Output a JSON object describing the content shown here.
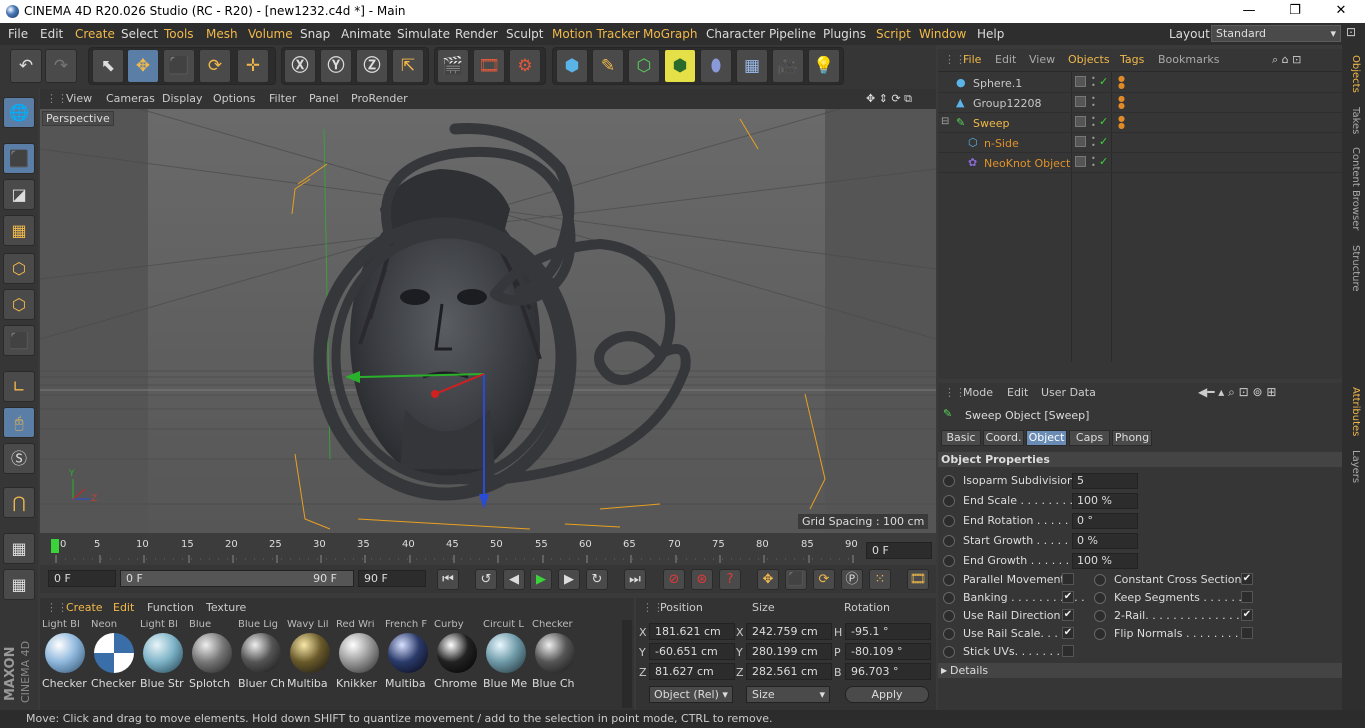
{
  "window": {
    "title": "CINEMA 4D R20.026 Studio (RC - R20) - [new1232.c4d *] - Main",
    "minimize": "—",
    "maximize": "❐",
    "close": "✕"
  },
  "menubar": {
    "items": [
      "File",
      "Edit",
      "Create",
      "Select",
      "Tools",
      "Mesh",
      "Volume",
      "Snap",
      "Animate",
      "Simulate",
      "Render",
      "Sculpt",
      "Motion Tracker",
      "MoGraph",
      "Character",
      "Pipeline",
      "Plugins",
      "Script",
      "Window",
      "Help"
    ],
    "layout_label": "Layout:",
    "layout_value": "Standard",
    "colors": {
      "highlight": "#f2b94a"
    }
  },
  "viewport": {
    "menu": [
      "View",
      "Cameras",
      "Display",
      "Options",
      "Filter",
      "Panel",
      "ProRender"
    ],
    "label": "Perspective",
    "grid_spacing": "Grid Spacing : 100 cm",
    "axis_y": "Y",
    "axis_z": "Z"
  },
  "timeline": {
    "ticks": [
      "0",
      "5",
      "10",
      "15",
      "20",
      "25",
      "30",
      "35",
      "40",
      "45",
      "50",
      "55",
      "60",
      "65",
      "70",
      "75",
      "80",
      "85",
      "90"
    ],
    "current_frame": "0 F"
  },
  "transport": {
    "start": "0 F",
    "range_start": "0 F",
    "range_end": "90 F",
    "end": "90 F"
  },
  "materials": {
    "menu": [
      "Create",
      "Edit",
      "Function",
      "Texture"
    ],
    "items": [
      {
        "top": "Light Bl",
        "label": "Checker",
        "color": "#8fb8dc"
      },
      {
        "top": "Neon",
        "label": "Checker",
        "color": "#3a6ea8"
      },
      {
        "top": "Light Bl",
        "label": "Blue Str",
        "color": "#7fb4c8"
      },
      {
        "top": "Blue",
        "label": "Splotch",
        "color": "#777777"
      },
      {
        "top": "Blue Lig",
        "label": "Bluer Ch",
        "color": "#555555"
      },
      {
        "top": "Wavy Lil",
        "label": "Multiba",
        "color": "#6a5a2a"
      },
      {
        "top": "Red Wri",
        "label": "Knikker",
        "color": "#9a9a9a"
      },
      {
        "top": "French F",
        "label": "Multiba",
        "color": "#2a3a6a"
      },
      {
        "top": "Curby",
        "label": "Chrome",
        "color": "#222222"
      },
      {
        "top": "Circuit L",
        "label": "Blue Me",
        "color": "#6f9aa8"
      },
      {
        "top": "Checker",
        "label": "Blue Ch",
        "color": "#555555"
      }
    ]
  },
  "coords": {
    "headers": [
      "Position",
      "Size",
      "Rotation"
    ],
    "rows": [
      {
        "a": "X",
        "pos": "181.621 cm",
        "b": "X",
        "size": "242.759 cm",
        "c": "H",
        "rot": "-95.1 °"
      },
      {
        "a": "Y",
        "pos": "-60.651 cm",
        "b": "Y",
        "size": "280.199 cm",
        "c": "P",
        "rot": "-80.109 °"
      },
      {
        "a": "Z",
        "pos": "81.627 cm",
        "b": "Z",
        "size": "282.561 cm",
        "c": "B",
        "rot": "96.703 °"
      }
    ],
    "mode": "Object (Rel)",
    "size_mode": "Size",
    "apply": "Apply"
  },
  "objects": {
    "menu": [
      "File",
      "Edit",
      "View",
      "Objects",
      "Tags",
      "Bookmarks"
    ],
    "rows": [
      {
        "name": "Sphere.1",
        "color": "#c8c8c8",
        "indent": 0
      },
      {
        "name": "Group12208",
        "color": "#c8c8c8",
        "indent": 0
      },
      {
        "name": "Sweep",
        "color": "#f2b94a",
        "indent": 0
      },
      {
        "name": "n-Side",
        "color": "#e0922a",
        "indent": 1
      },
      {
        "name": "NeoKnot Object",
        "color": "#e0922a",
        "indent": 1
      }
    ]
  },
  "attributes": {
    "menu": [
      "Mode",
      "Edit",
      "User Data"
    ],
    "title": "Sweep Object [Sweep]",
    "tabs": [
      "Basic",
      "Coord.",
      "Object",
      "Caps",
      "Phong"
    ],
    "section": "Object Properties",
    "props": [
      {
        "label": "Isoparm Subdivision",
        "value": "5"
      },
      {
        "label": "End Scale . . . . . . . . . .",
        "value": "100 %"
      },
      {
        "label": "End Rotation . . . . . .",
        "value": "0 °"
      },
      {
        "label": "Start Growth . . . . . .",
        "value": "0 %"
      },
      {
        "label": "End Growth . . . . . . .",
        "value": "100 %"
      }
    ],
    "checks_left": [
      {
        "label": "Parallel Movement",
        "checked": ""
      },
      {
        "label": "Banking . . . . . . . . . . .",
        "checked": "✔"
      },
      {
        "label": "Use Rail Direction",
        "checked": "✔"
      },
      {
        "label": "Use Rail Scale. . . . .",
        "checked": "✔"
      },
      {
        "label": "Stick UVs. . . . . . . .",
        "checked": ""
      }
    ],
    "checks_right": [
      {
        "label": "Constant Cross Section",
        "checked": "✔"
      },
      {
        "label": "Keep Segments . . . . . . .",
        "checked": ""
      },
      {
        "label": "2-Rail. . . . . . . . . . . . . . . .",
        "checked": "✔"
      },
      {
        "label": "Flip Normals . . . . . . . . .",
        "checked": ""
      }
    ],
    "details": "Details"
  },
  "sidetabs": [
    "Objects",
    "Takes",
    "Content Browser",
    "Structure",
    "Attributes",
    "Layers"
  ],
  "brand": {
    "line1": "MAXON",
    "line2": "CINEMA 4D"
  },
  "status": "Move: Click and drag to move elements. Hold down SHIFT to quantize movement / add to the selection in point mode, CTRL to remove."
}
